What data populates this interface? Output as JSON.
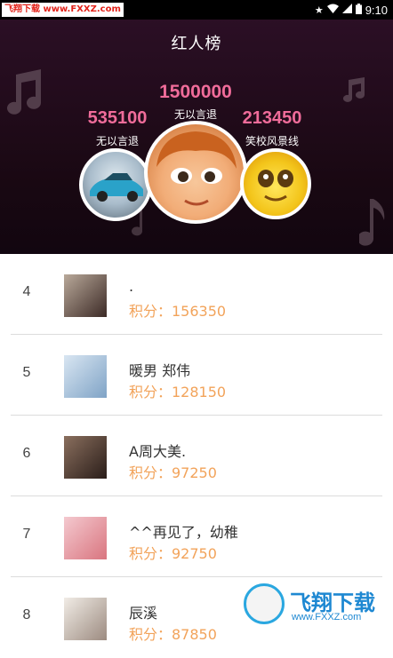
{
  "status_bar": {
    "watermark": "飞翔下载 www.FXXZ.com",
    "time": "9:10"
  },
  "header": {
    "title": "红人榜"
  },
  "podium": [
    {
      "place": 1,
      "score": "1500000",
      "name": "无以言退"
    },
    {
      "place": 2,
      "score": "535100",
      "name": "无以言退"
    },
    {
      "place": 3,
      "score": "213450",
      "name": "笑校风景线"
    }
  ],
  "ranking": [
    {
      "rank": "4",
      "name": ".",
      "points": "积分：156350"
    },
    {
      "rank": "5",
      "name": "暖男 郑伟",
      "points": "积分：128150"
    },
    {
      "rank": "6",
      "name": "A周大美.",
      "points": "积分：97250"
    },
    {
      "rank": "7",
      "name": "^^再见了，幼稚",
      "points": "积分：92750"
    },
    {
      "rank": "8",
      "name": "辰溪",
      "points": "积分：87850"
    }
  ],
  "watermark_bottom": {
    "text": "飞翔下载",
    "url": "www.FXXZ.com"
  },
  "colors": {
    "accent_pink": "#f06c9a",
    "points_orange": "#f2a35a",
    "hero_bg": "#1f0a19"
  }
}
